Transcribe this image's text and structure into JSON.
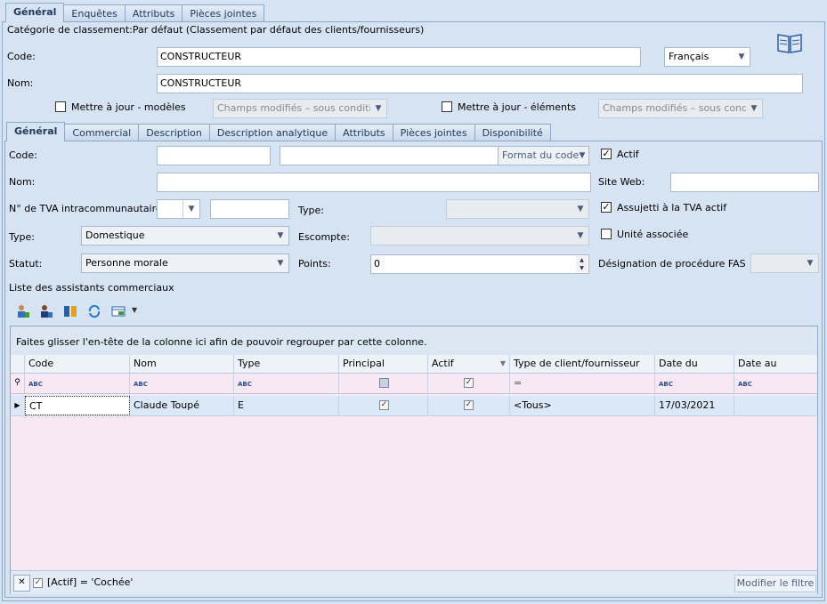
{
  "top_tabs": [
    "Général",
    "Enquêtes",
    "Attributs",
    "Pièces jointes"
  ],
  "category_text": "Catégorie de classement:Par défaut (Classement par défaut des clients/fournisseurs)",
  "code": {
    "label": "Code:",
    "value": "CONSTRUCTEUR"
  },
  "language": "Français",
  "nom": {
    "label": "Nom:",
    "value": "CONSTRUCTEUR"
  },
  "update_models": {
    "label": "Mettre à jour - modèles",
    "select": "Champs modifiés – sous condition"
  },
  "update_elements": {
    "label": "Mettre à jour - éléments",
    "select": "Champs modifiés – sous condit"
  },
  "inner_tabs": [
    "Général",
    "Commercial",
    "Description",
    "Description analytique",
    "Attributs",
    "Pièces jointes",
    "Disponibilité"
  ],
  "form": {
    "code_label": "Code:",
    "code_format": "Format du code",
    "actif_label": "Actif",
    "nom_label": "Nom:",
    "site_web_label": "Site Web:",
    "tva_label": "N° de TVA intracommunautaire:",
    "type_label": "Type:",
    "assujetti_label": "Assujetti à la TVA actif",
    "type2_label": "Type:",
    "type2_value": "Domestique",
    "escompte_label": "Escompte:",
    "unite_label": "Unité associée",
    "statut_label": "Statut:",
    "statut_value": "Personne morale",
    "points_label": "Points:",
    "points_value": "0",
    "fas_label": "Désignation de procédure FAS"
  },
  "assistants_title": "Liste des assistants commerciaux",
  "toolbar_icons": [
    "add-person-icon",
    "edit-person-icon",
    "book-columns-icon",
    "refresh-icon",
    "grid-export-icon"
  ],
  "grid": {
    "group_hint": "Faites glisser l'en-tête de la colonne ici afin de pouvoir regrouper par cette colonne.",
    "columns": [
      "Code",
      "Nom",
      "Type",
      "Principal",
      "Actif",
      "Type de client/fournisseur",
      "Date du",
      "Date au"
    ],
    "filter_row": {
      "abc": "ABC",
      "equals": "="
    },
    "rows": [
      {
        "code": "CT",
        "nom": "Claude Toupé",
        "type": "E",
        "principal": true,
        "actif": true,
        "type_client": "<Tous>",
        "date_du": "17/03/2021",
        "date_au": ""
      }
    ],
    "filter_expression": "[Actif] = 'Cochée'",
    "modify_filter": "Modifier le filtre"
  },
  "colors": {
    "background": "#d6e3f3",
    "grid_body": "#f7e8f4",
    "row_selected": "#dbe8f8",
    "tab_text": "#1e395b"
  }
}
